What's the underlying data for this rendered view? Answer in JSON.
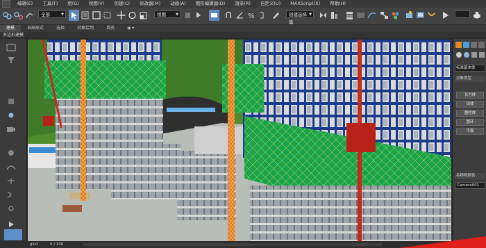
{
  "menu": {
    "items": [
      "编辑(E)",
      "工具(T)",
      "组(G)",
      "视图(V)",
      "创建(C)",
      "修改器(M)",
      "动画(A)",
      "图形编辑器(D)",
      "渲染(R)",
      "自定义(U)",
      "MAXScript(X)",
      "帮助(H)"
    ]
  },
  "toolbar": {
    "selection_filter": "全部",
    "reference_coord": "视图",
    "named_selection": "创建选择集"
  },
  "ribbon": {
    "tabs": [
      "建模",
      "自由形式",
      "选择",
      "对象绘制",
      "填充"
    ],
    "sub_label": "多边形建模"
  },
  "command_panel": {
    "category": "标准基本体",
    "rollout_object_type": "对象类型",
    "buttons": [
      "长方体",
      "球体",
      "圆柱体",
      "圆环",
      "平面"
    ],
    "rollout_name": "名称和颜色",
    "name_value": "Camera001"
  },
  "timeline": {
    "frame": "0 / 100",
    "left_tag": "glist"
  },
  "colors": {
    "accent_blue": "#5e88b8",
    "net_green": "#1aa34a",
    "tower_crane": "#e07a1a",
    "hoist_red": "#c8281e",
    "steel_blue": "#1e3a8a"
  }
}
